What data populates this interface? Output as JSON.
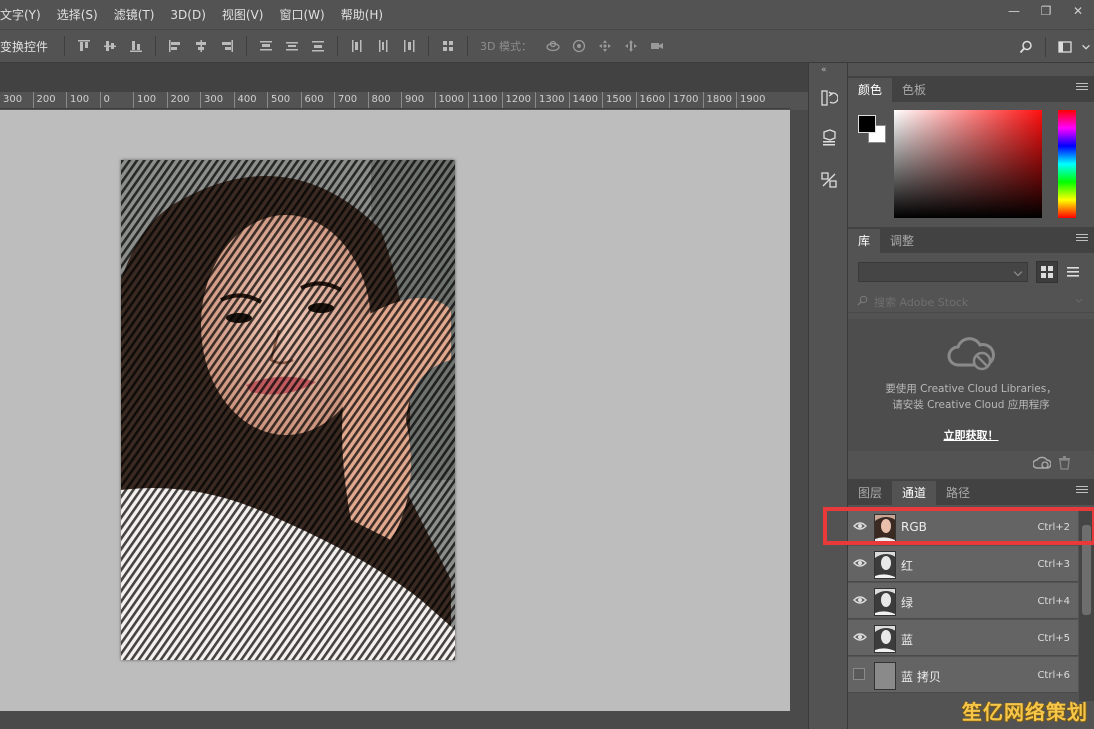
{
  "menu": [
    "文字(Y)",
    "选择(S)",
    "滤镜(T)",
    "3D(D)",
    "视图(V)",
    "窗口(W)",
    "帮助(H)"
  ],
  "window_controls": [
    "minimize",
    "restore",
    "close"
  ],
  "options_bar": {
    "transform_controls_label": "变换控件",
    "mode_3d_label": "3D 模式："
  },
  "ruler": {
    "labels": [
      "300",
      "200",
      "100",
      "0",
      "100",
      "200",
      "300",
      "400",
      "500",
      "600",
      "700",
      "800",
      "900",
      "1000",
      "1100",
      "1200",
      "1300",
      "1400",
      "1500",
      "1600",
      "1700",
      "1800",
      "1900"
    ]
  },
  "color_panel": {
    "tabs": [
      "颜色",
      "色板"
    ],
    "active_tab": 0,
    "foreground": "#000000",
    "background": "#ffffff"
  },
  "library_panel": {
    "tabs": [
      "库",
      "调整"
    ],
    "active_tab": 0,
    "search_placeholder": "搜索 Adobe Stock",
    "message_line1": "要使用 Creative Cloud Libraries，",
    "message_line2": "请安装 Creative Cloud 应用程序",
    "link_text": "立即获取！"
  },
  "channels_panel": {
    "tabs": [
      "图层",
      "通道",
      "路径"
    ],
    "active_tab": 1,
    "channels": [
      {
        "name": "RGB",
        "shortcut": "Ctrl+2",
        "visible": true,
        "thumb": "color"
      },
      {
        "name": "红",
        "shortcut": "Ctrl+3",
        "visible": true,
        "thumb": "gray"
      },
      {
        "name": "绿",
        "shortcut": "Ctrl+4",
        "visible": true,
        "thumb": "gray"
      },
      {
        "name": "蓝",
        "shortcut": "Ctrl+5",
        "visible": true,
        "thumb": "gray"
      },
      {
        "name": "蓝 拷贝",
        "shortcut": "Ctrl+6",
        "visible": false,
        "thumb": "blank"
      }
    ]
  },
  "highlight_color": "#e83a3a",
  "watermark": "笙亿网络策划"
}
